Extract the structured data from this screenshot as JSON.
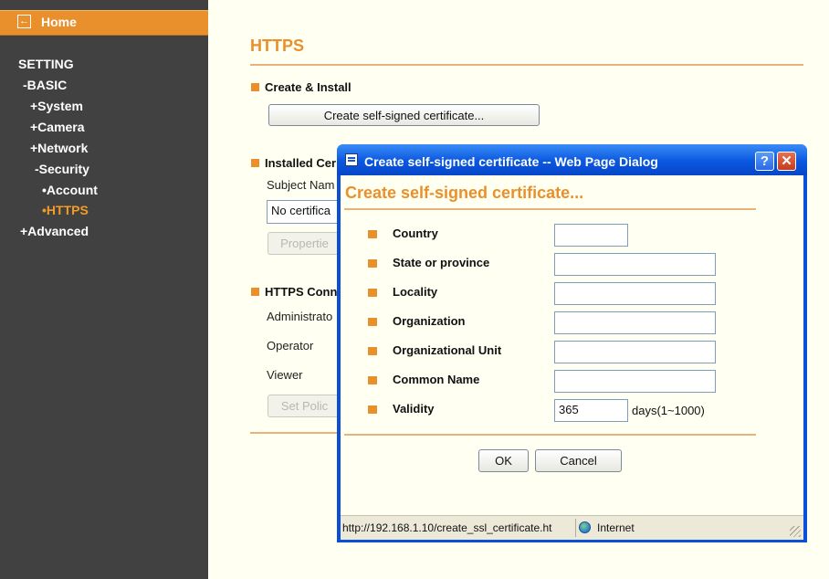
{
  "sidebar": {
    "home_label": "Home",
    "setting": "SETTING",
    "basic": "-BASIC",
    "system": "+System",
    "camera": "+Camera",
    "network": "+Network",
    "security": "-Security",
    "account": "•Account",
    "https": "•HTTPS",
    "advanced": "+Advanced"
  },
  "main": {
    "title": "HTTPS",
    "create_install": "Create & Install",
    "create_button": "Create self-signed certificate...",
    "installed_heading": "Installed Cer",
    "subject_name": "Subject Nam",
    "subject_value": "No certifica",
    "properties_button": "Propertie",
    "https_conn": "HTTPS Conn",
    "administrator": "Administrato",
    "operator": "Operator",
    "viewer": "Viewer",
    "set_policy_button": "Set Polic"
  },
  "dialog": {
    "window_title": "Create self-signed certificate -- Web Page Dialog",
    "help": "?",
    "close": "✕",
    "heading": "Create self-signed certificate...",
    "fields": [
      {
        "label": "Country",
        "value": ""
      },
      {
        "label": "State or province",
        "value": ""
      },
      {
        "label": "Locality",
        "value": ""
      },
      {
        "label": "Organization",
        "value": ""
      },
      {
        "label": "Organizational Unit",
        "value": ""
      },
      {
        "label": "Common Name",
        "value": ""
      },
      {
        "label": "Validity",
        "value": "365"
      }
    ],
    "validity_hint": "days(1~1000)",
    "ok": "OK",
    "cancel": "Cancel",
    "status_url": "http://192.168.1.10/create_ssl_certificate.ht",
    "status_zone": "Internet"
  },
  "colors": {
    "accent": "#e9902c",
    "sidebar_bg": "#414141",
    "active_nav": "#f39c25",
    "titlebar": "#0a57e0"
  }
}
